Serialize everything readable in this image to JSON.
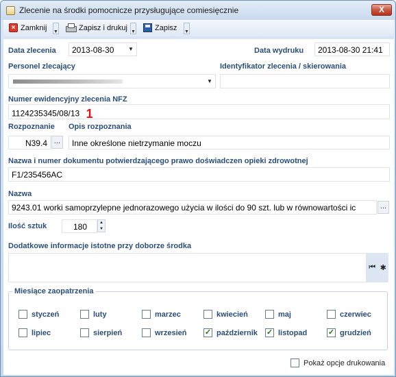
{
  "window": {
    "title": "Zlecenie na środki pomocnicze przysługujące comiesięcznie",
    "close_symbol": "X"
  },
  "toolbar": {
    "close_label": "Zamknij",
    "save_print_label": "Zapisz i drukuj",
    "save_label": "Zapisz"
  },
  "form": {
    "data_zlecenia_label": "Data zlecenia",
    "data_zlecenia_value": "2013-08-30",
    "data_wydruku_label": "Data wydruku",
    "data_wydruku_value": "2013-08-30 21:41",
    "personel_label": "Personel zlecający",
    "identyfikator_label": "Identyfikator zlecenia / skierowania",
    "identyfikator_value": "",
    "numer_label": "Numer ewidencyjny zlecenia NFZ",
    "numer_value": "1124235345/08/13",
    "numer_marker": "1",
    "rozpoznanie_label": "Rozpoznanie",
    "rozpoznanie_value": "N39.4",
    "opis_label": "Opis rozpoznania",
    "opis_value": "Inne określone nietrzymanie moczu",
    "dokument_label": "Nazwa i numer dokumentu potwierdzającego prawo doświadczen opieki zdrowotnej",
    "dokument_value": "F1/235456AC",
    "nazwa_label": "Nazwa",
    "nazwa_value": "9243.01 worki samoprzylepne jednorazowego użycia w ilości do 90 szt. lub w równowartości ic",
    "ilosc_label": "Ilość sztuk",
    "ilosc_value": "180",
    "dodatkowe_label": "Dodatkowe informacje istotne przy doborze środka",
    "dodatkowe_value": "",
    "ellipsis": "..."
  },
  "months": {
    "group_label": "Miesiące zaopatrzenia",
    "items": [
      {
        "label": "styczeń",
        "checked": false
      },
      {
        "label": "luty",
        "checked": false
      },
      {
        "label": "marzec",
        "checked": false
      },
      {
        "label": "kwiecień",
        "checked": false
      },
      {
        "label": "maj",
        "checked": false
      },
      {
        "label": "czerwiec",
        "checked": false
      },
      {
        "label": "lipiec",
        "checked": false
      },
      {
        "label": "sierpień",
        "checked": false
      },
      {
        "label": "wrzesień",
        "checked": false
      },
      {
        "label": "październik",
        "checked": true
      },
      {
        "label": "listopad",
        "checked": true
      },
      {
        "label": "grudzień",
        "checked": true
      }
    ]
  },
  "footer": {
    "print_options_label": "Pokaż opcje drukowania",
    "print_options_checked": false
  },
  "colors": {
    "label": "#2a4d7a",
    "check": "#1a7a1a",
    "marker": "#dd1111"
  }
}
